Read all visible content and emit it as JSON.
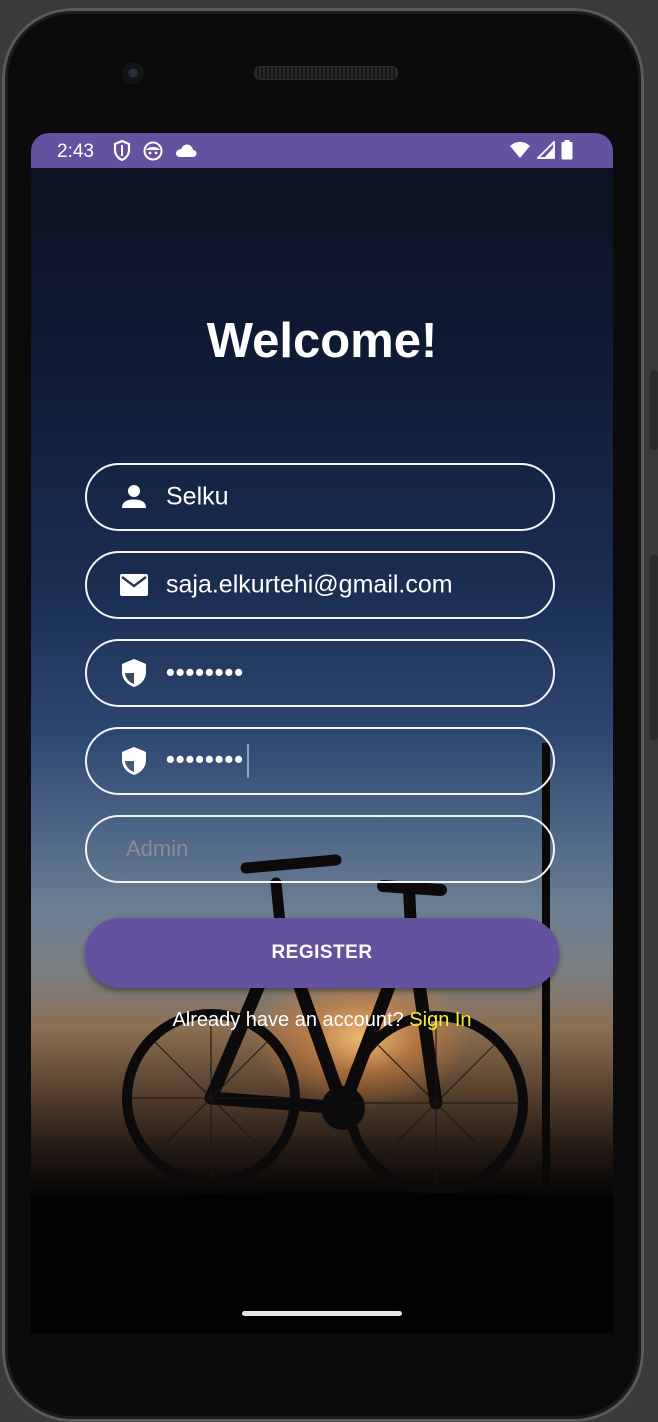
{
  "status_bar": {
    "time": "2:43",
    "left_icons": [
      "shield-icon",
      "android-face-icon",
      "cloud-icon"
    ],
    "right_icons": [
      "wifi-icon",
      "cellular-signal-icon",
      "battery-icon"
    ],
    "color": "#6452a0"
  },
  "screen": {
    "title": "Welcome!"
  },
  "form": {
    "username": {
      "icon": "person-icon",
      "value": "Selku"
    },
    "email": {
      "icon": "mail-icon",
      "value": "saja.elkurtehi@gmail.com"
    },
    "password": {
      "icon": "shield-icon",
      "value": "••••••••"
    },
    "confirm_password": {
      "icon": "shield-icon",
      "value": "••••••••"
    },
    "role": {
      "placeholder": "Admin"
    }
  },
  "register_button": {
    "label": "REGISTER",
    "color": "#6452a0"
  },
  "signin": {
    "prompt": "Already have an account?",
    "link": "Sign In",
    "link_color": "#f3ee3a"
  }
}
